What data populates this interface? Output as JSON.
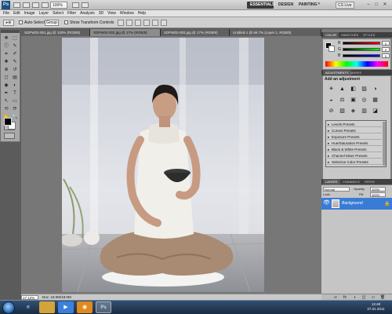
{
  "app": {
    "logo": "Ps",
    "zoom": "100%",
    "cs_live": "CS Live"
  },
  "workspaces": {
    "essentials": "ESSENTIALS",
    "design": "DESIGN",
    "painting": "PAINTING",
    "more": "»"
  },
  "window_buttons": [
    "–",
    "□",
    "✕"
  ],
  "menu": [
    "File",
    "Edit",
    "Image",
    "Layer",
    "Select",
    "Filter",
    "Analysis",
    "3D",
    "View",
    "Window",
    "Help"
  ],
  "options": {
    "tool": "▸⊕",
    "auto_select": "Auto-Select:",
    "group": "Group",
    "show_transform": "Show Transform Controls"
  },
  "tools": [
    "move-icon",
    "marquee-icon",
    "lasso-icon",
    "quick-select-icon",
    "crop-icon",
    "eyedropper-icon",
    "heal-icon",
    "brush-icon",
    "clone-stamp-icon",
    "history-brush-icon",
    "eraser-icon",
    "gradient-icon",
    "blur-icon",
    "dodge-icon",
    "pen-icon",
    "type-icon",
    "path-select-icon",
    "shape-icon",
    "3d-rotate-icon",
    "3d-orbit-icon",
    "hand-icon",
    "zoom-icon"
  ],
  "tool_glyphs": [
    "✥",
    "⬚",
    "ⓛ",
    "✎",
    "⌗",
    "✐",
    "✚",
    "✎",
    "⊕",
    "↺",
    "◻",
    "▤",
    "◉",
    "◐",
    "✒",
    "T",
    "↖",
    "▭",
    "⟲",
    "⟳",
    "✋",
    "🔍"
  ],
  "tabs": [
    {
      "label": "XDPW02-001.jpg @ 100% (RGB/8)",
      "active": false
    },
    {
      "label": "XDPW02-002.jpg @ 17% (RGB/8)",
      "active": true
    },
    {
      "label": "XDPW02-003.jpg @ 17% (RGB/8)",
      "active": false
    },
    {
      "label": "Untitled-1 @ 66.7% (Layer 1, RGB/8)",
      "active": false
    }
  ],
  "status": {
    "zoom": "17.12%",
    "doc": "Doc: 18.0M/18.0M"
  },
  "colors_panel": {
    "tabs": [
      "COLOR",
      "SWATCHES",
      "STYLES"
    ],
    "channels": [
      {
        "label": "R",
        "value": "0"
      },
      {
        "label": "G",
        "value": "0"
      },
      {
        "label": "B",
        "value": "0"
      }
    ]
  },
  "adjustments_panel": {
    "tabs": [
      "ADJUSTMENTS",
      "MASKS"
    ],
    "title": "Add an adjustment",
    "icons_row1": [
      "☀",
      "▲",
      "◧",
      "▨",
      "◑"
    ],
    "icons_row2": [
      "◒",
      "⚖",
      "▣",
      "◎",
      "▦"
    ],
    "icons_row3": [
      "⊘",
      "▧",
      "◈",
      "▥",
      "◪"
    ],
    "presets": [
      "Levels Presets",
      "Curves Presets",
      "Exposure Presets",
      "Hue/Saturation Presets",
      "Black & White Presets",
      "Channel Mixer Presets",
      "Selective Color Presets"
    ]
  },
  "layers_panel": {
    "tabs": [
      "LAYERS",
      "CHANNELS",
      "PATHS"
    ],
    "blend_mode": "Normal",
    "opacity_label": "Opacity:",
    "opacity_value": "100%",
    "lock_label": "Lock:",
    "fill_label": "Fill:",
    "fill_value": "100%",
    "layer_name": "Background",
    "footer_icons": [
      "∞",
      "fx",
      "◑",
      "◫",
      "▭",
      "🗑"
    ]
  },
  "taskbar": {
    "items": [
      "ie-icon",
      "explorer-icon",
      "media-player-icon",
      "firefox-icon",
      "photoshop-icon"
    ],
    "glyphs": [
      "e",
      "📁",
      "▶",
      "◉",
      "Ps"
    ],
    "time": "12:48",
    "date": "27.01.2011"
  }
}
